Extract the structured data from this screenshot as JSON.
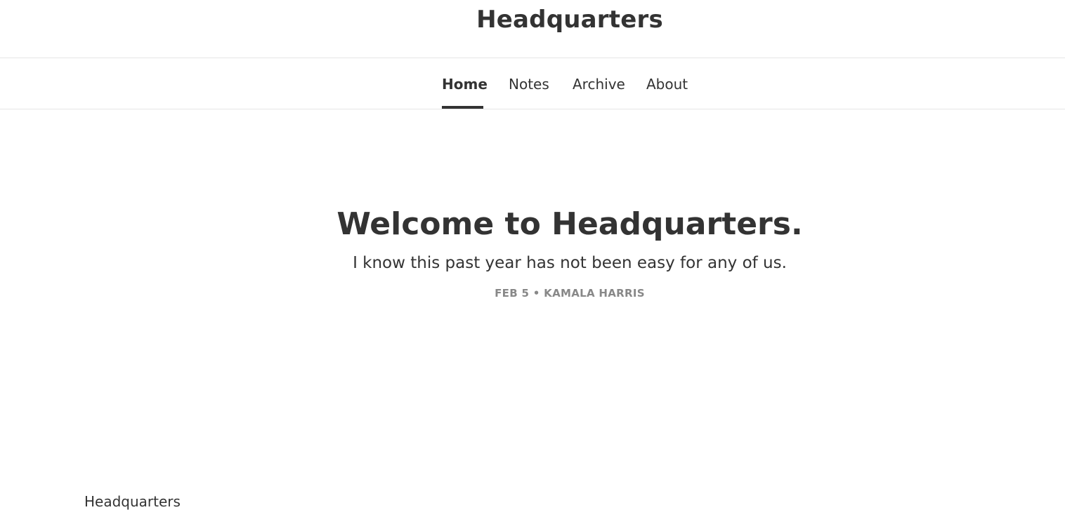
{
  "header": {
    "site_title": "Headquarters"
  },
  "nav": {
    "tabs": [
      {
        "label": "Home",
        "active": true
      },
      {
        "label": "Notes",
        "active": false
      },
      {
        "label": "Archive",
        "active": false
      },
      {
        "label": "About",
        "active": false
      }
    ]
  },
  "post": {
    "title": "Welcome to Headquarters.",
    "subtitle": "I know this past year has not been easy for any of us.",
    "date": "FEB 5",
    "separator": "•",
    "author": "KAMALA HARRIS"
  },
  "footer": {
    "site_title": "Headquarters"
  },
  "colors": {
    "text": "#333333",
    "meta": "#888888",
    "divider": "#e6e6e6",
    "background": "#ffffff"
  }
}
